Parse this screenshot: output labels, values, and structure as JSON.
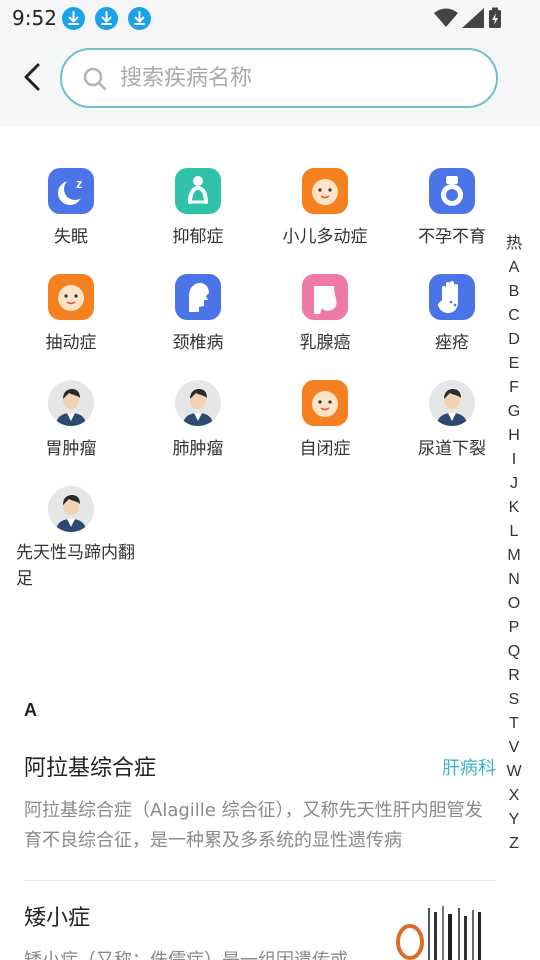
{
  "status_bar": {
    "time": "9:52",
    "download_icons": [
      "download-icon",
      "download-icon",
      "download-icon"
    ],
    "right_icons": [
      "wifi-icon",
      "cell-signal-icon",
      "battery-charging-icon"
    ]
  },
  "header": {
    "back_icon": "chevron-left-icon",
    "search_placeholder": "搜索疾病名称"
  },
  "hot_diseases": [
    {
      "label": "失眠",
      "icon": "sleep-moon-icon"
    },
    {
      "label": "抑郁症",
      "icon": "depressed-person-icon"
    },
    {
      "label": "小儿多动症",
      "icon": "baby-face-icon"
    },
    {
      "label": "不孕不育",
      "icon": "fertility-icon"
    },
    {
      "label": "抽动症",
      "icon": "baby-face-icon"
    },
    {
      "label": "颈椎病",
      "icon": "neck-icon"
    },
    {
      "label": "乳腺癌",
      "icon": "breast-icon"
    },
    {
      "label": "痤疮",
      "icon": "acne-hand-icon"
    },
    {
      "label": "胃肿瘤",
      "icon": "doctor-avatar-icon"
    },
    {
      "label": "肺肿瘤",
      "icon": "doctor-avatar-icon"
    },
    {
      "label": "自闭症",
      "icon": "baby-face-icon"
    },
    {
      "label": "尿道下裂",
      "icon": "doctor-avatar-icon"
    },
    {
      "label": "先天性马蹄内翻足",
      "icon": "doctor-avatar-icon"
    }
  ],
  "index_letters": [
    "热",
    "A",
    "B",
    "C",
    "D",
    "E",
    "F",
    "G",
    "H",
    "I",
    "J",
    "K",
    "L",
    "M",
    "N",
    "O",
    "P",
    "Q",
    "R",
    "S",
    "T",
    "V",
    "W",
    "X",
    "Y",
    "Z"
  ],
  "section": {
    "letter": "A",
    "items": [
      {
        "title": "阿拉基综合症",
        "department": "肝病科",
        "description": "阿拉基综合症（Alagille 综合征），又称先天性肝内胆管发育不良综合征，是一种累及多系统的显性遗传病"
      },
      {
        "title": "矮小症",
        "department": "",
        "description": "矮小症（又称：侏儒症）是一组因遗传或"
      }
    ]
  },
  "colors": {
    "accent": "#3cb4c8",
    "search_border": "#6fc1c9",
    "download_blue": "#1aa3e8"
  }
}
